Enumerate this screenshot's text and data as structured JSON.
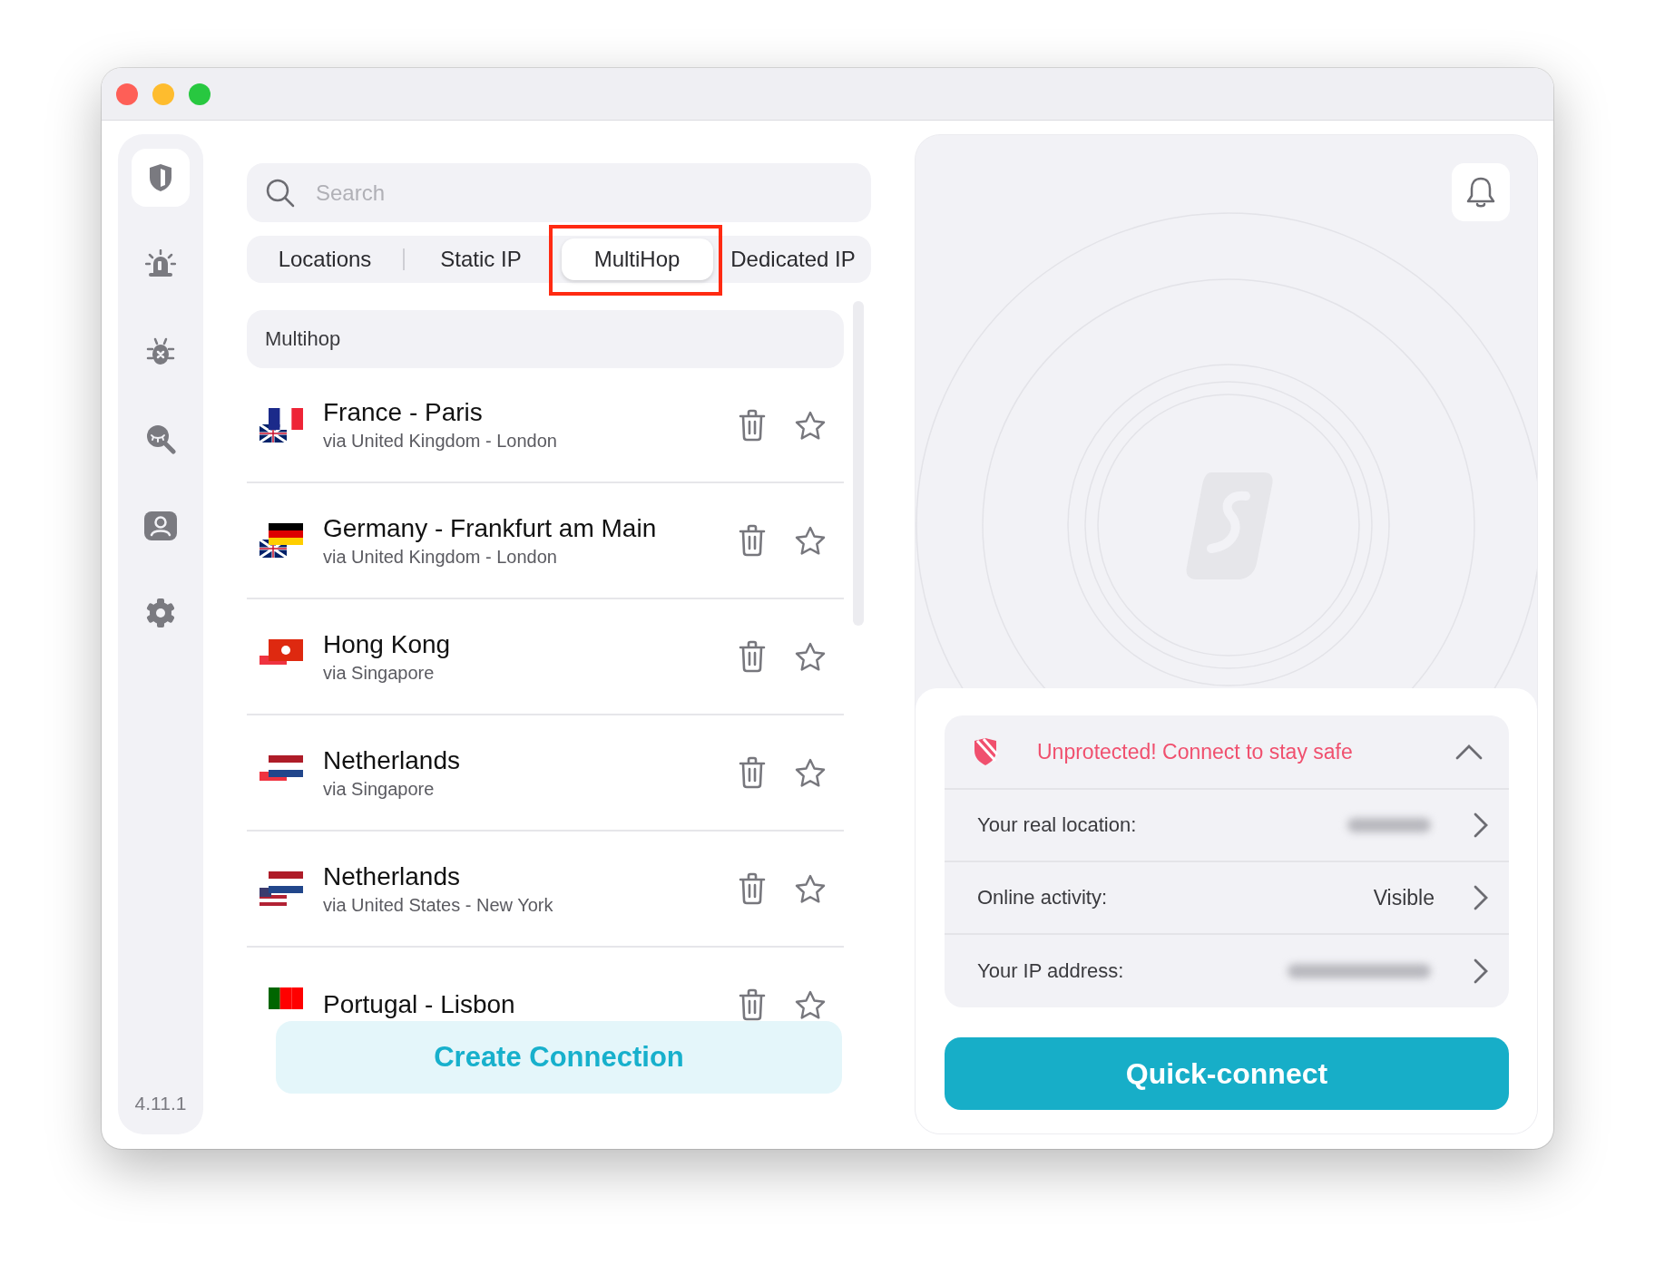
{
  "sidebar": {
    "items": [
      {
        "kind": "shield",
        "selected": true
      },
      {
        "kind": "alarm",
        "selected": false
      },
      {
        "kind": "bug",
        "selected": false
      },
      {
        "kind": "eye-search",
        "selected": false
      },
      {
        "kind": "person",
        "selected": false
      },
      {
        "kind": "gear",
        "selected": false
      }
    ],
    "version": "4.11.1"
  },
  "search": {
    "placeholder": "Search"
  },
  "tabs": [
    {
      "label": "Locations",
      "selected": false,
      "highlighted": false
    },
    {
      "label": "Static IP",
      "selected": false,
      "highlighted": false
    },
    {
      "label": "MultiHop",
      "selected": true,
      "highlighted": true
    },
    {
      "label": "Dedicated IP",
      "selected": false,
      "highlighted": false
    }
  ],
  "list": {
    "header": "Multihop",
    "rows": [
      {
        "name": "France - Paris",
        "via": "via United Kingdom - London",
        "flags": [
          {
            "kind": "fr"
          },
          {
            "kind": "gb"
          }
        ]
      },
      {
        "name": "Germany - Frankfurt am Main",
        "via": "via United Kingdom - London",
        "flags": [
          {
            "kind": "de"
          },
          {
            "kind": "gb"
          }
        ]
      },
      {
        "name": "Hong Kong",
        "via": "via Singapore",
        "flags": [
          {
            "kind": "hk"
          },
          {
            "kind": "sg"
          }
        ]
      },
      {
        "name": "Netherlands",
        "via": "via Singapore",
        "flags": [
          {
            "kind": "nl"
          },
          {
            "kind": "sg"
          }
        ]
      },
      {
        "name": "Netherlands",
        "via": "via United States - New York",
        "flags": [
          {
            "kind": "nl"
          },
          {
            "kind": "us"
          }
        ]
      },
      {
        "name": "Portugal - Lisbon",
        "flags": [
          {
            "kind": "pt"
          }
        ]
      }
    ]
  },
  "create_button": "Create Connection",
  "status": {
    "title": "Unprotected! Connect to stay safe",
    "expanded": true,
    "rows": [
      {
        "label": "Your real location:",
        "blurred": true
      },
      {
        "label": "Online activity:",
        "value": "Visible",
        "blurred": false
      },
      {
        "label": "Your IP address:",
        "blurred": true
      }
    ]
  },
  "quick_connect": "Quick-connect"
}
